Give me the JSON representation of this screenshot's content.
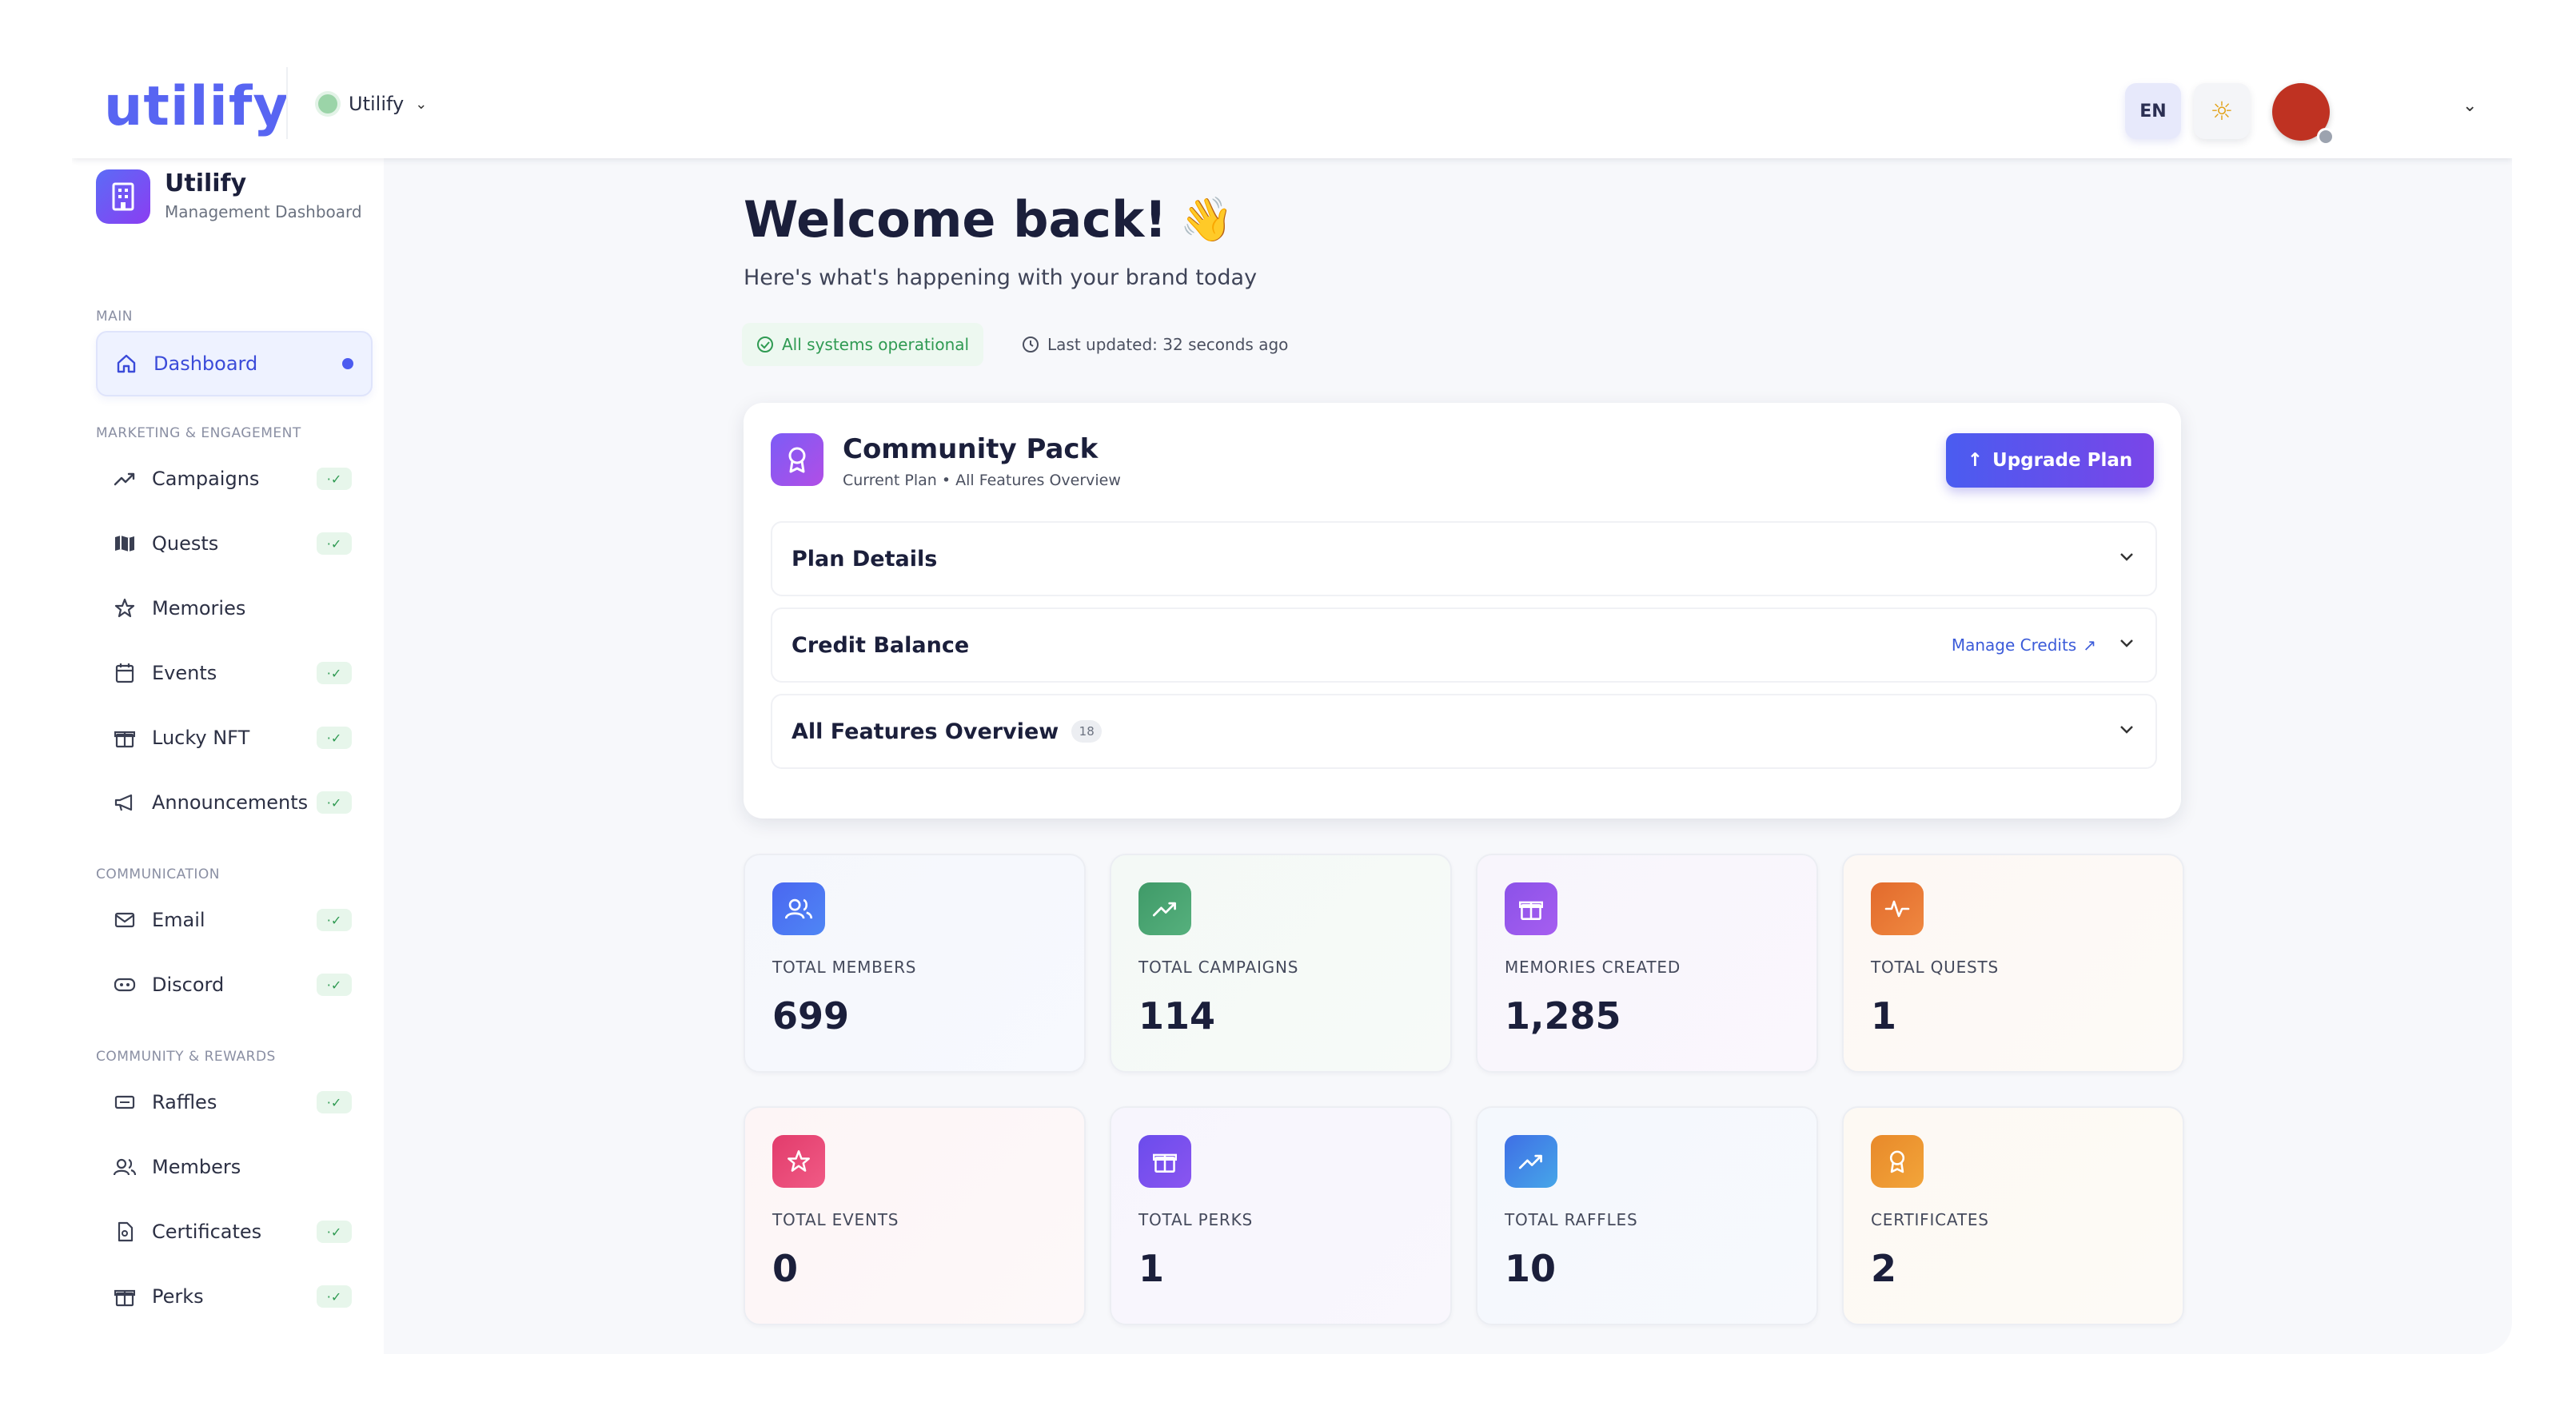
{
  "header": {
    "logo": "utilify",
    "brand_switch": "Utilify",
    "lang": "EN"
  },
  "sidebar": {
    "brand_title": "Utilify",
    "brand_sub": "Management Dashboard",
    "sections": {
      "main": "MAIN",
      "marketing": "MARKETING & ENGAGEMENT",
      "communication": "COMMUNICATION",
      "community": "COMMUNITY & REWARDS"
    },
    "badge": "·✓",
    "items": {
      "dashboard": "Dashboard",
      "campaigns": "Campaigns",
      "quests": "Quests",
      "memories": "Memories",
      "events": "Events",
      "lucky_nft": "Lucky NFT",
      "announcements": "Announcements",
      "email": "Email",
      "discord": "Discord",
      "raffles": "Raffles",
      "members": "Members",
      "certificates": "Certificates",
      "perks": "Perks"
    }
  },
  "main": {
    "welcome": "Welcome back!",
    "wave": "👋",
    "subtitle": "Here's what's happening with your brand today",
    "status": "All systems operational",
    "updated": "Last updated: 32 seconds ago",
    "plan": {
      "title": "Community Pack",
      "subtitle": "Current Plan • All Features Overview",
      "upgrade": "Upgrade Plan",
      "details": "Plan Details",
      "credits": "Credit Balance",
      "manage": "Manage Credits",
      "features": "All Features Overview",
      "features_count": "18"
    },
    "stats": {
      "members": {
        "label": "TOTAL MEMBERS",
        "value": "699"
      },
      "campaigns": {
        "label": "TOTAL CAMPAIGNS",
        "value": "114"
      },
      "memories": {
        "label": "MEMORIES CREATED",
        "value": "1,285"
      },
      "quests": {
        "label": "TOTAL QUESTS",
        "value": "1"
      },
      "events": {
        "label": "TOTAL EVENTS",
        "value": "0"
      },
      "perks": {
        "label": "TOTAL PERKS",
        "value": "1"
      },
      "raffles": {
        "label": "TOTAL RAFFLES",
        "value": "10"
      },
      "certificates": {
        "label": "CERTIFICATES",
        "value": "2"
      }
    }
  },
  "colors": {
    "accent": "#5865f2",
    "success": "#2f9a52",
    "avatar": "#bf3222"
  }
}
